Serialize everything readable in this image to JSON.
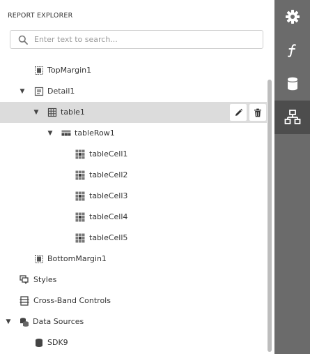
{
  "panel": {
    "title": "REPORT EXPLORER"
  },
  "search": {
    "placeholder": "Enter text to search..."
  },
  "tree": [
    {
      "label": "TopMargin1",
      "icon": "margin-band-icon",
      "expanded": null
    },
    {
      "label": "Detail1",
      "icon": "detail-band-icon",
      "expanded": true
    },
    {
      "label": "table1",
      "icon": "table-icon",
      "expanded": true,
      "selected": true
    },
    {
      "label": "tableRow1",
      "icon": "table-row-icon",
      "expanded": true
    },
    {
      "label": "tableCell1",
      "icon": "table-cell-icon",
      "expanded": null
    },
    {
      "label": "tableCell2",
      "icon": "table-cell-icon",
      "expanded": null
    },
    {
      "label": "tableCell3",
      "icon": "table-cell-icon",
      "expanded": null
    },
    {
      "label": "tableCell4",
      "icon": "table-cell-icon",
      "expanded": null
    },
    {
      "label": "tableCell5",
      "icon": "table-cell-icon",
      "expanded": null
    },
    {
      "label": "BottomMargin1",
      "icon": "margin-band-icon",
      "expanded": null
    },
    {
      "label": "Styles",
      "icon": "styles-icon",
      "expanded": null
    },
    {
      "label": "Cross-Band Controls",
      "icon": "cross-band-icon",
      "expanded": null
    },
    {
      "label": "Data Sources",
      "icon": "data-sources-icon",
      "expanded": true
    },
    {
      "label": "SDK9",
      "icon": "database-icon",
      "expanded": null
    }
  ],
  "row_actions": [
    "edit-icon",
    "delete-icon"
  ],
  "sidebar": {
    "items": [
      {
        "icon": "gear-icon",
        "active": false
      },
      {
        "icon": "function-icon",
        "active": false
      },
      {
        "icon": "database-icon",
        "active": false
      },
      {
        "icon": "report-explorer-icon",
        "active": true
      }
    ]
  },
  "colors": {
    "sidebar_bg": "#6b6b6b",
    "sidebar_active": "#4d4d4d",
    "selected_row": "#dcdcdc",
    "scrollbar": "#bdbdbd"
  }
}
